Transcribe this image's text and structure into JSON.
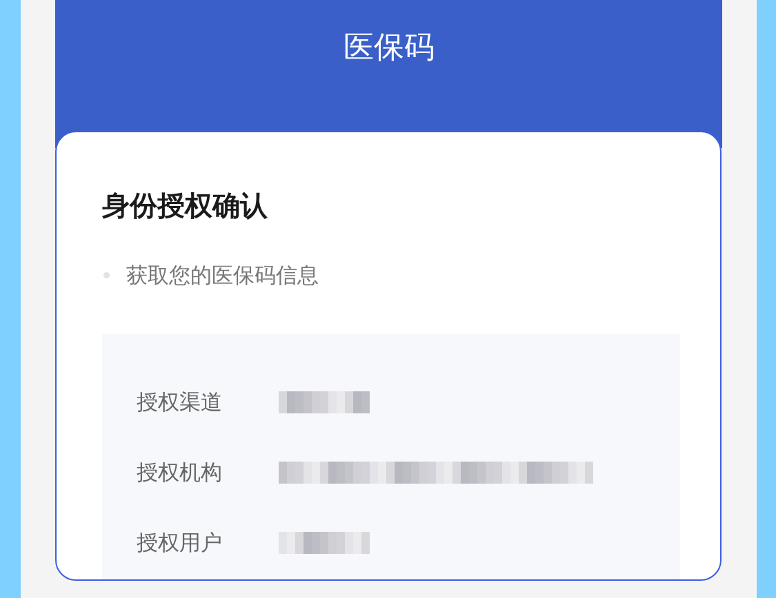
{
  "header": {
    "title": "医保码"
  },
  "card": {
    "title": "身份授权确认",
    "bullets": [
      "获取您的医保码信息"
    ],
    "rows": [
      {
        "label": "授权渠道",
        "kind": "short"
      },
      {
        "label": "授权机构",
        "kind": "long"
      },
      {
        "label": "授权用户",
        "kind": "short"
      }
    ]
  }
}
